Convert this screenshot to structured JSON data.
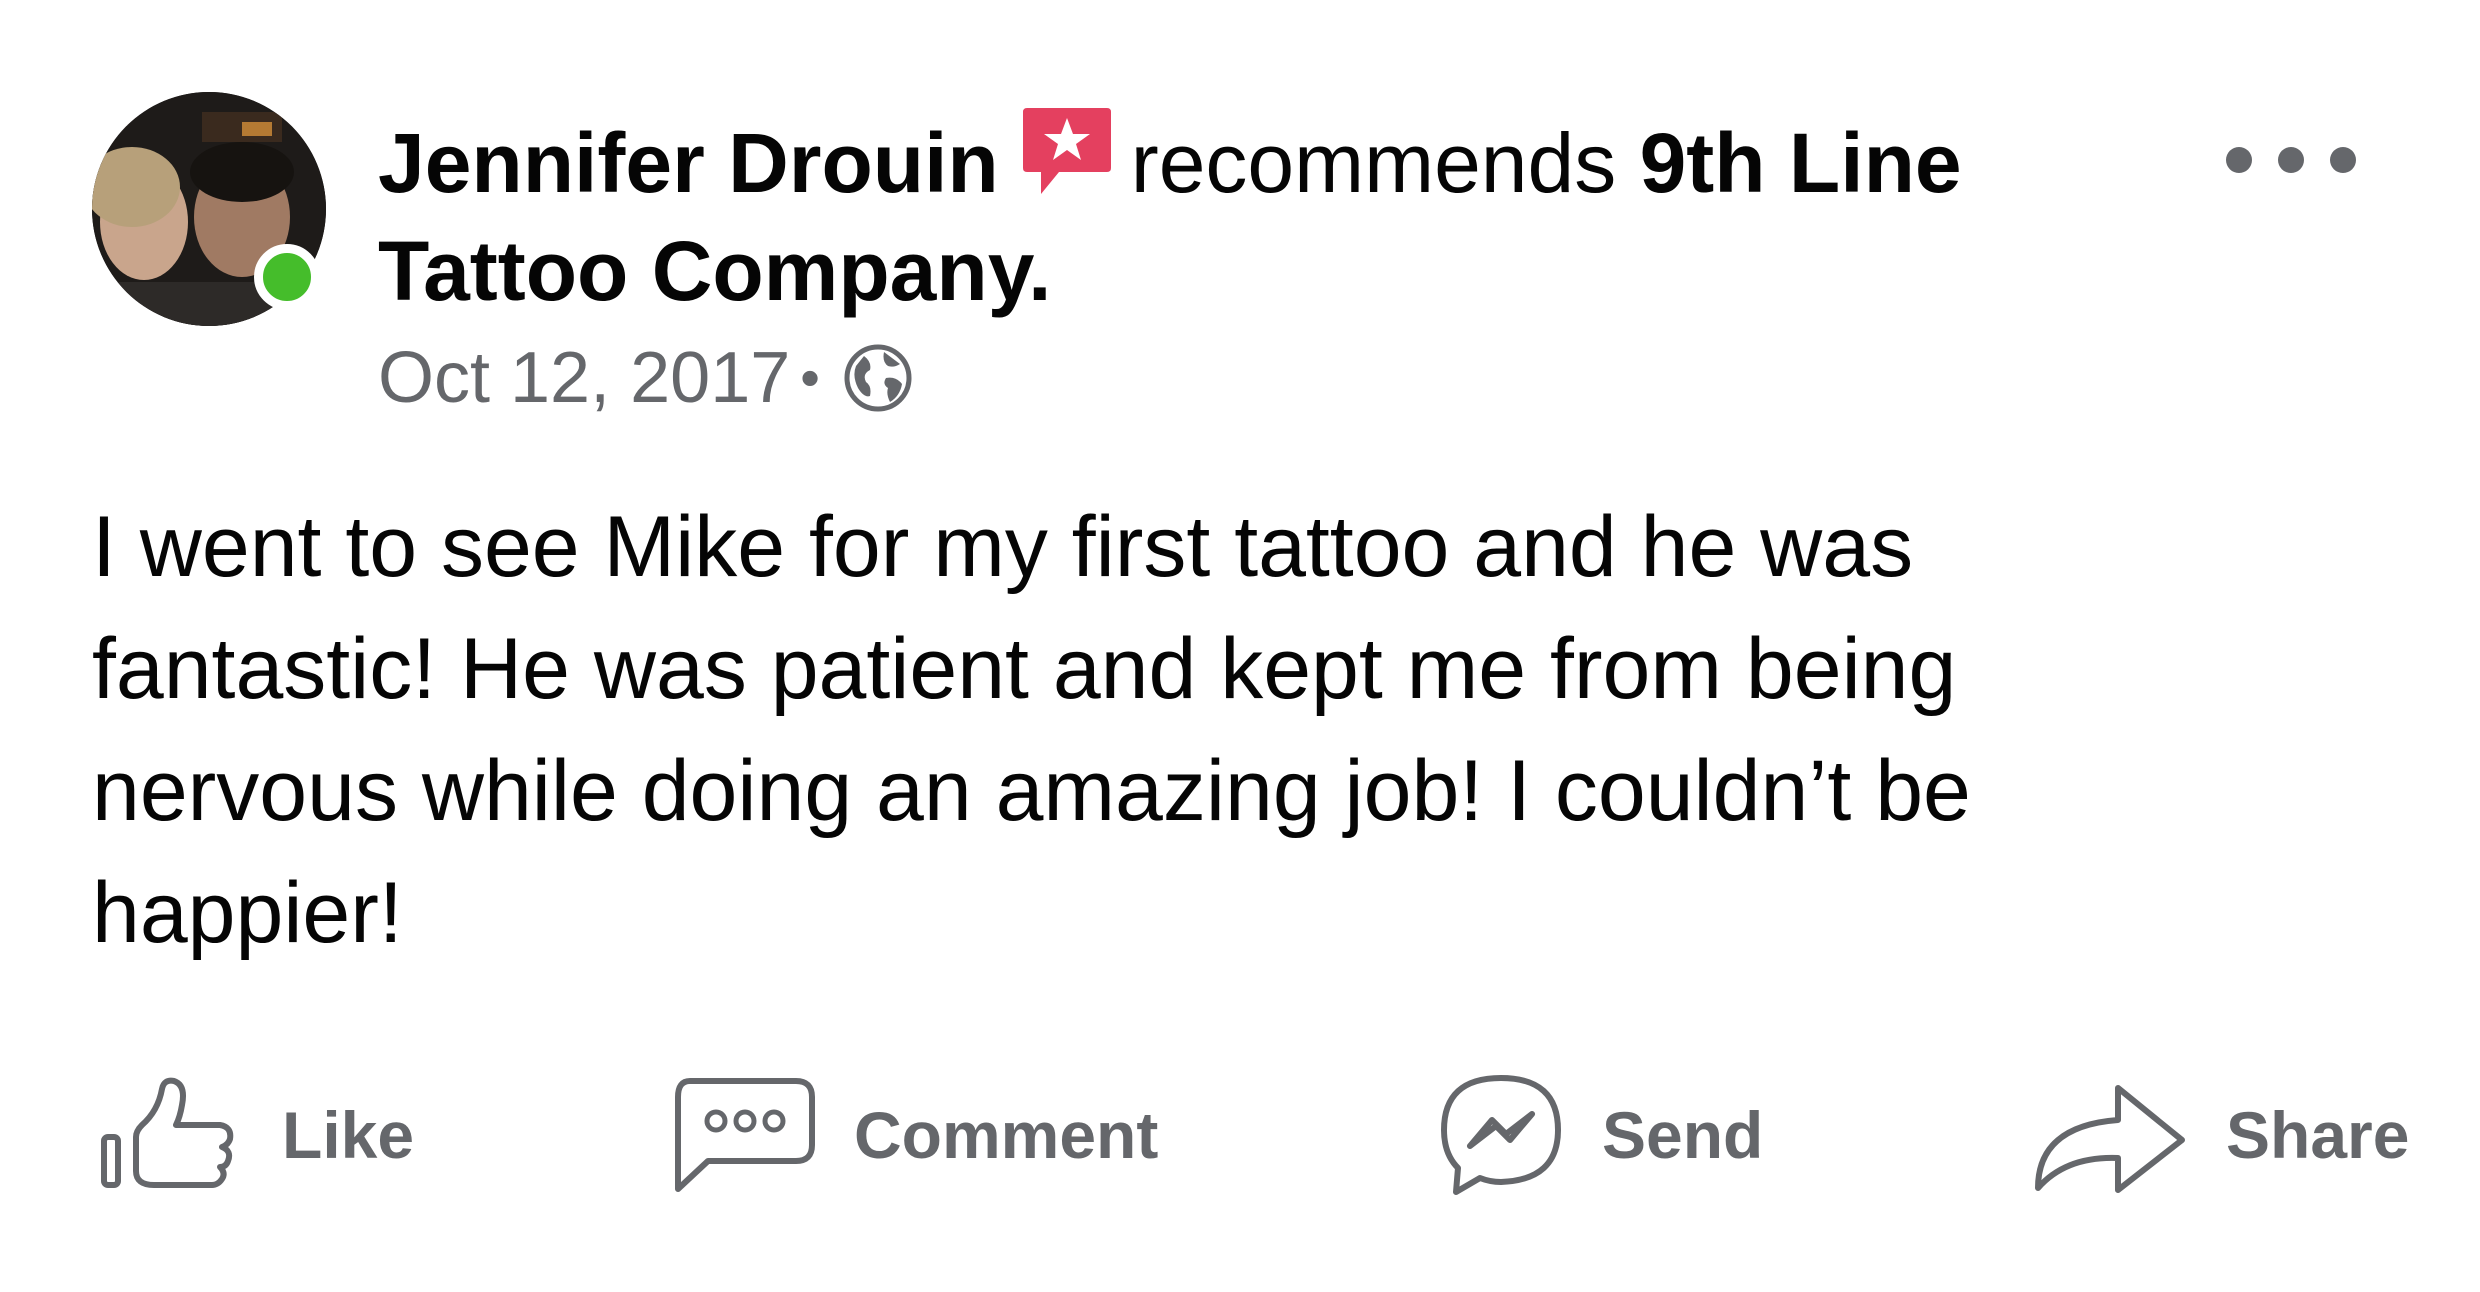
{
  "post": {
    "author": "Jennifer Drouin",
    "verb": "recommends",
    "target": "9th Line Tattoo Company.",
    "date": "Oct 12, 2017",
    "separator": "•",
    "privacy_icon": "globe-icon",
    "badge_icon": "recommendation-star-icon",
    "online": true,
    "message": "I went to see Mike for my first tattoo and he was fantastic! He was patient and kept me from being nervous while doing an amazing job! I couldn’t be happier!"
  },
  "actions": {
    "like": "Like",
    "comment": "Comment",
    "send": "Send",
    "share": "Share"
  },
  "colors": {
    "text_primary": "#050505",
    "text_secondary": "#65676b",
    "badge": "#e4405f",
    "online": "#45bd2b"
  }
}
